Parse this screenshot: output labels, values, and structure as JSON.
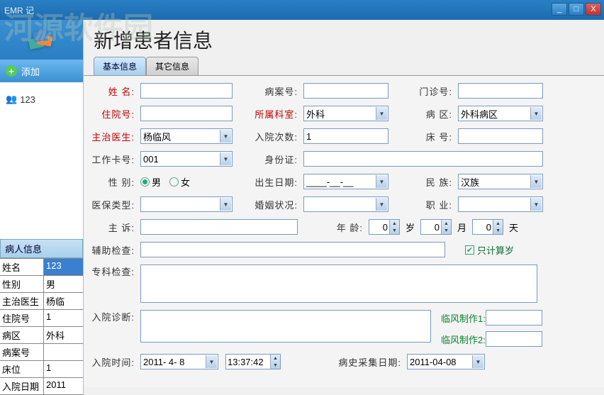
{
  "titlebar": {
    "text": "EMR         记"
  },
  "win": {
    "min": "_",
    "max": "□",
    "close": "X"
  },
  "side": {
    "add": "添加",
    "tree": {
      "item1": "123"
    },
    "pinfo_header": "病人信息",
    "rows": [
      {
        "k": "姓名",
        "v": "123",
        "sel": true
      },
      {
        "k": "性别",
        "v": "男"
      },
      {
        "k": "主治医生",
        "v": "杨临"
      },
      {
        "k": "住院号",
        "v": "1"
      },
      {
        "k": "病区",
        "v": "外科"
      },
      {
        "k": "病案号",
        "v": ""
      },
      {
        "k": "床位",
        "v": "1"
      },
      {
        "k": "入院日期",
        "v": "2011"
      }
    ]
  },
  "header_title": "新增患者信息",
  "tabs": {
    "t1": "基本信息",
    "t2": "其它信息"
  },
  "form": {
    "name_lbl": "姓 名:",
    "name": "",
    "case_lbl": "病案号:",
    "case": "",
    "outp_lbl": "门诊号:",
    "outp": "",
    "inp_lbl": "住院号:",
    "inp": "",
    "dept_lbl": "所属科室:",
    "dept": "外科",
    "ward_lbl": "病 区:",
    "ward": "外科病区",
    "doctor_lbl": "主治医生:",
    "doctor": "杨临风",
    "admit_cnt_lbl": "入院次数:",
    "admit_cnt": "1",
    "bed_lbl": "床 号:",
    "bed": "",
    "workno_lbl": "工作卡号:",
    "workno": "001",
    "idcard_lbl": "身份证:",
    "idcard": "",
    "gender_lbl": "性 别:",
    "gender_m": "男",
    "gender_f": "女",
    "birth_lbl": "出生日期:",
    "birth": "____-__-__",
    "nation_lbl": "民 族:",
    "nation": "汉族",
    "ins_lbl": "医保类型:",
    "ins": "",
    "marriage_lbl": "婚姻状况:",
    "marriage": "",
    "job_lbl": "职 业:",
    "job": "",
    "complaint_lbl": "主 诉:",
    "complaint": "",
    "age_lbl": "年 龄:",
    "age_y": "0",
    "age_y_u": "岁",
    "age_m": "0",
    "age_m_u": "月",
    "age_d": "0",
    "age_d_u": "天",
    "aux_lbl": "辅助检查:",
    "aux": "",
    "only_age": "只计算岁",
    "spec_lbl": "专科检查:",
    "spec": "",
    "adm_diag_lbl": "入院诊断:",
    "adm_diag": "",
    "lf1": "临风制作1:",
    "lf2": "临风制作2:",
    "adm_time_lbl": "入院时间:",
    "adm_date": "2011- 4- 8",
    "adm_hms": "13:37:42",
    "hist_date_lbl": "病史采集日期:",
    "hist_date": "2011-04-08"
  },
  "watermark": "河源软件园"
}
